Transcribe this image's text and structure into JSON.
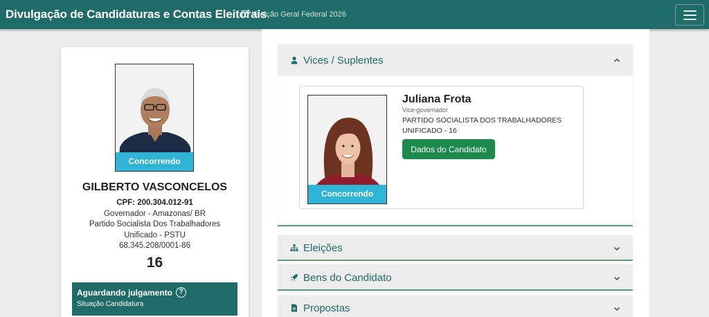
{
  "navbar": {
    "brand": "Divulgação de Candidaturas e Contas Eleitorais",
    "election": "Eleição Geral Federal 2026",
    "election_icon": "edit-icon",
    "menu_icon": "hamburger-icon"
  },
  "candidate": {
    "status_badge": "Concorrendo",
    "name": "GILBERTO VASCONCELOS",
    "cpf": "CPF: 200.304.012-91",
    "office": "Governador - Amazonas/ BR",
    "party_line1": "Partido Socialista Dos Trabalhadores",
    "party_line2": "Unificado - PSTU",
    "cnpj": "68.345.208/0001-86",
    "number": "16",
    "situation_title": "Aguardando julgamento",
    "situation_sub": "Situação Candidatura"
  },
  "accordion": {
    "vices": {
      "title": "Vices / Suplentes",
      "icon": "user-icon",
      "expanded": true,
      "vice": {
        "name": "Juliana Frota",
        "role": "Vice-governador",
        "party_line1": "PARTIDO SOCIALISTA DOS TRABALHADORES",
        "party_line2": "UNIFICADO - 16",
        "status_badge": "Concorrendo",
        "button": "Dados do Candidato"
      }
    },
    "eleicoes": {
      "title": "Eleições",
      "icon": "sitemap-icon"
    },
    "bens": {
      "title": "Bens do Candidato",
      "icon": "rocket-icon"
    },
    "propostas": {
      "title": "Propostas",
      "icon": "file-icon"
    }
  },
  "colors": {
    "primary": "#1f6b68",
    "badge": "#2fb3d6",
    "button": "#1c8a4d"
  }
}
